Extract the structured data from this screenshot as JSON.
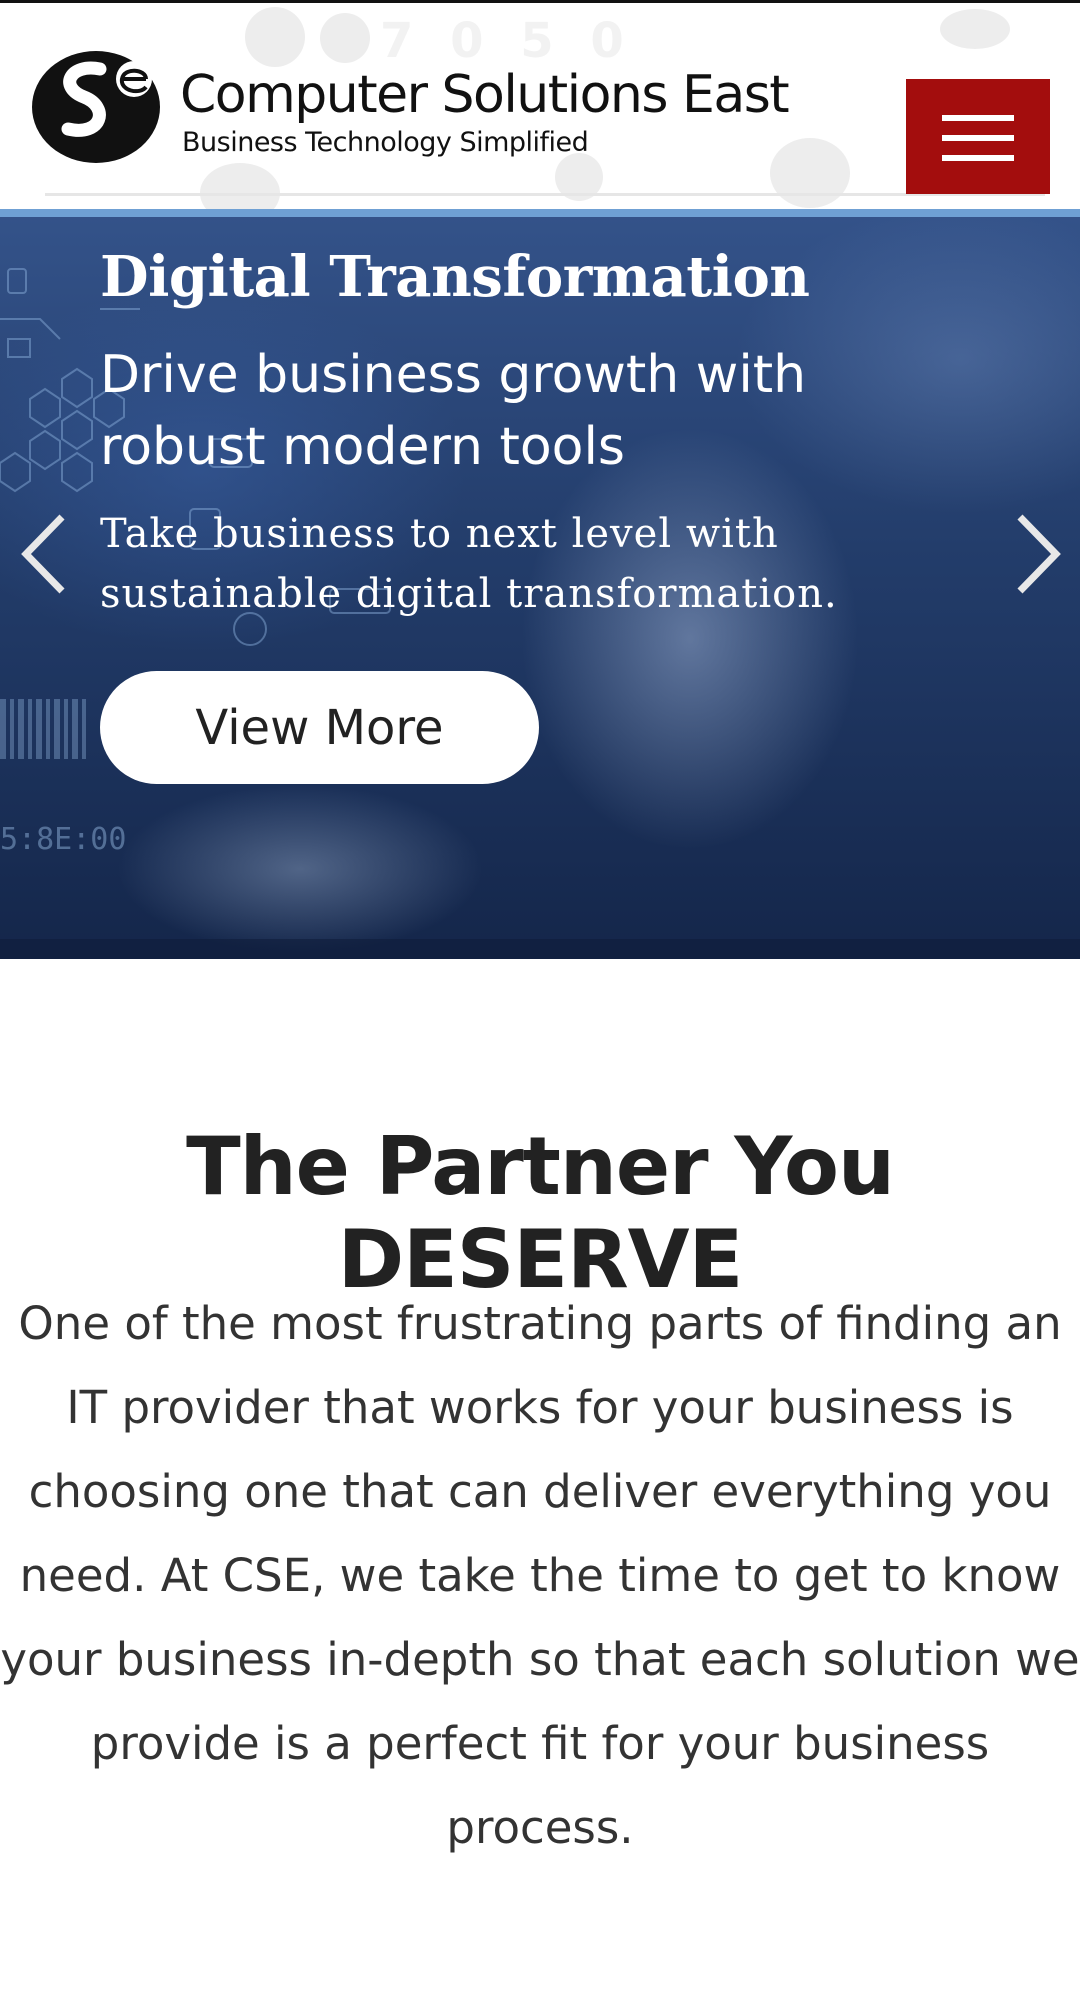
{
  "header": {
    "phone_faded": "7 0  5  0",
    "brand_name": "Computer Solutions East",
    "tagline": "Business Technology Simplified",
    "logo_text": "Se",
    "menu_icon": "hamburger-menu-icon",
    "menu_color": "#a30d0d"
  },
  "hero": {
    "title": "Digital Transformation",
    "subtitle": "Drive business growth with robust modern tools",
    "description": "Take business to next level with sustainable digital transformation.",
    "button_label": "View More",
    "prev_icon": "chevron-left-icon",
    "next_icon": "chevron-right-icon"
  },
  "content": {
    "heading": "The Partner You DESERVE",
    "body": "One of the most frustrating parts of finding an IT provider that works for your business is choosing one that can deliver everything you need. At CSE, we take the time to get to know your business in-depth so that each solution we provide is a perfect fit for your business process."
  }
}
